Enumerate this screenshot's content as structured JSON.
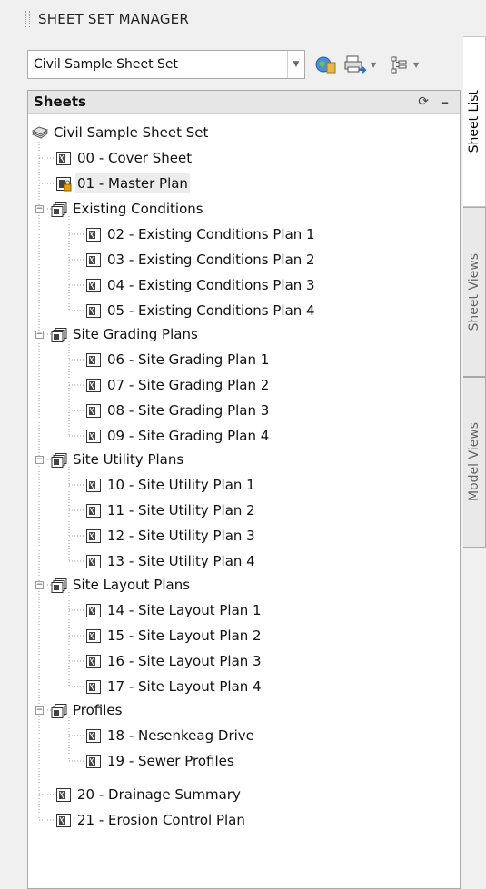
{
  "window": {
    "title": "SHEET SET MANAGER"
  },
  "toolbar": {
    "sheet_set_combo": "Civil Sample Sheet Set",
    "buttons": [
      "sheet-set-properties-icon",
      "publish-icon",
      "sheet-view-options-icon"
    ]
  },
  "panel": {
    "title": "Sheets",
    "refresh_icon": "refresh-icon",
    "collapse_label": "–"
  },
  "tree": {
    "root": "Civil Sample Sheet Set",
    "sheet_00": "00 - Cover Sheet",
    "sheet_01": "01 - Master Plan",
    "group_existing": "Existing Conditions",
    "sheet_02": "02 - Existing Conditions Plan 1",
    "sheet_03": "03 - Existing Conditions Plan 2",
    "sheet_04": "04 - Existing Conditions Plan 3",
    "sheet_05": "05 - Existing Conditions Plan 4",
    "group_grading": "Site Grading Plans",
    "sheet_06": "06 - Site Grading Plan 1",
    "sheet_07": "07 - Site Grading Plan 2",
    "sheet_08": "08 - Site Grading Plan 3",
    "sheet_09": "09 - Site Grading Plan 4",
    "group_utility": "Site Utility Plans",
    "sheet_10": "10 - Site Utility Plan 1",
    "sheet_11": "11 - Site Utility Plan 2",
    "sheet_12": "12 - Site Utility Plan 3",
    "sheet_13": "13 - Site Utility Plan 4",
    "group_layout": "Site Layout Plans",
    "sheet_14": "14 - Site Layout Plan 1",
    "sheet_15": "15 - Site Layout Plan 2",
    "sheet_16": "16 - Site Layout Plan 3",
    "sheet_17": "17 - Site Layout Plan 4",
    "group_profiles": "Profiles",
    "sheet_18": "18 - Nesenkeag Drive",
    "sheet_19": "19 - Sewer Profiles",
    "sheet_20": "20 - Drainage Summary",
    "sheet_21": "21 - Erosion Control Plan"
  },
  "tabs": {
    "sheet_list": "Sheet List",
    "sheet_views": "Sheet Views",
    "model_views": "Model Views"
  },
  "colors": {
    "panel_bg": "#ffffff",
    "frame_bg": "#f0f0f0",
    "selection": "#ececec"
  }
}
